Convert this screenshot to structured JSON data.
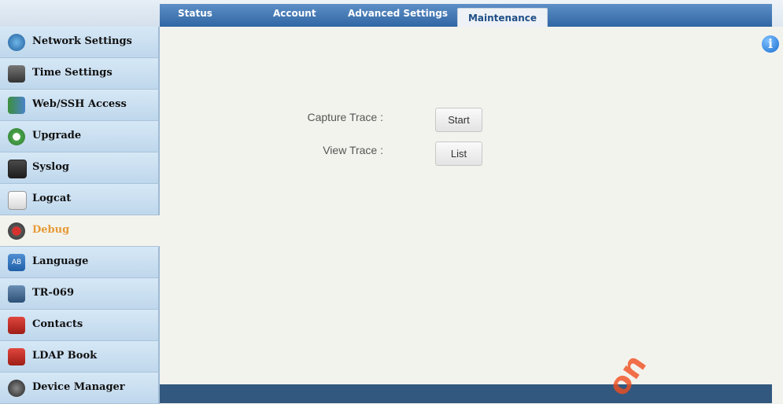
{
  "nav": {
    "tabs": [
      "Status",
      "Account",
      "Advanced Settings",
      "Maintenance"
    ],
    "active_tab": "Maintenance"
  },
  "sidebar": {
    "items": [
      {
        "label": "Network Settings",
        "icon": "network-settings-icon"
      },
      {
        "label": "Time Settings",
        "icon": "time-settings-icon"
      },
      {
        "label": "Web/SSH Access",
        "icon": "web-ssh-access-icon"
      },
      {
        "label": "Upgrade",
        "icon": "upgrade-icon"
      },
      {
        "label": "Syslog",
        "icon": "syslog-icon"
      },
      {
        "label": "Logcat",
        "icon": "logcat-icon"
      },
      {
        "label": "Debug",
        "icon": "debug-icon"
      },
      {
        "label": "Language",
        "icon": "language-icon"
      },
      {
        "label": "TR-069",
        "icon": "tr069-icon"
      },
      {
        "label": "Contacts",
        "icon": "contacts-icon"
      },
      {
        "label": "LDAP Book",
        "icon": "ldap-book-icon"
      },
      {
        "label": "Device Manager",
        "icon": "device-manager-icon"
      }
    ],
    "active": "Debug",
    "active_color": "#e69a36"
  },
  "main": {
    "capture_label": "Capture Trace :",
    "capture_button": "Start",
    "view_label": "View Trace :",
    "view_button": "List"
  },
  "info_icon": "info-icon",
  "watermark": "on",
  "colors": {
    "nav_bar": "#2f66a4",
    "footer": "#33587f",
    "sidebar": "#cde4f5"
  }
}
